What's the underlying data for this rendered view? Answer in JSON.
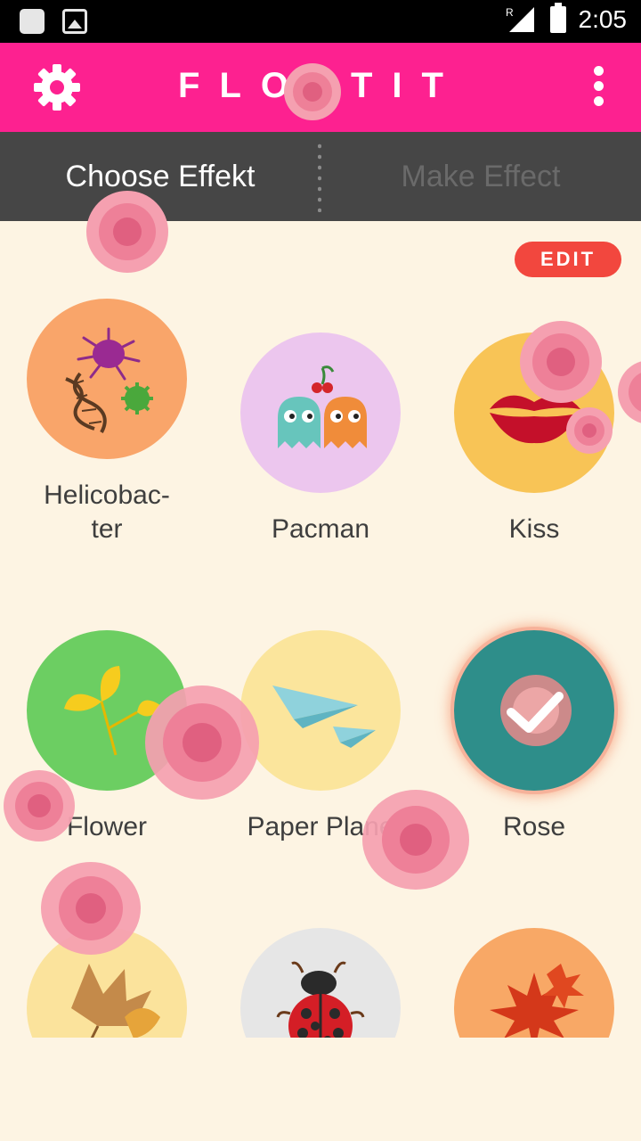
{
  "status_bar": {
    "time": "2:05",
    "signal_label": "R"
  },
  "app_bar": {
    "title": "FLOATIT"
  },
  "tabs": [
    {
      "label": "Choose Effekt",
      "active": true
    },
    {
      "label": "Make Effect",
      "active": false
    }
  ],
  "edit_button": {
    "label": "EDIT"
  },
  "effects": [
    {
      "label": "Helicobac-\nter",
      "color": "#f9a56a",
      "icon": "bacteria-icon"
    },
    {
      "label": "Pacman",
      "color": "#ecc6ee",
      "icon": "pacman-ghosts-icon"
    },
    {
      "label": "Kiss",
      "color": "#f8c456",
      "icon": "lips-icon"
    },
    {
      "label": "Flower",
      "color": "#6cce62",
      "icon": "ginkgo-leaf-icon"
    },
    {
      "label": "Paper Plane",
      "color": "#fbe59c",
      "icon": "paper-plane-icon"
    },
    {
      "label": "Rose",
      "color": "#2e8e8a",
      "icon": "checkmark-icon",
      "selected": true
    },
    {
      "label": "",
      "color": "#fbe39c",
      "icon": "autumn-leaves-icon"
    },
    {
      "label": "",
      "color": "#e6e6e6",
      "icon": "ladybug-icon"
    },
    {
      "label": "",
      "color": "#f8a866",
      "icon": "maple-leaf-icon"
    }
  ],
  "colors": {
    "accent": "#fd2190",
    "tab_bg": "#464646",
    "background": "#fdf4e3",
    "edit": "#f2473e"
  }
}
